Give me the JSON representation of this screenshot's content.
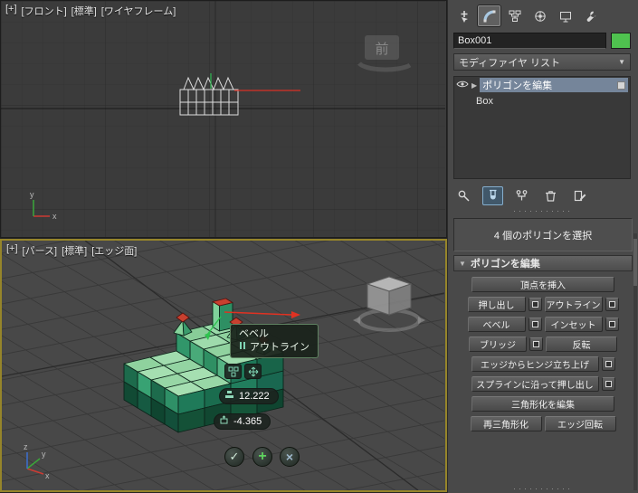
{
  "viewport_front": {
    "menu_plus": "[+]",
    "menu_view": "[フロント]",
    "menu_shading": "[標準]",
    "menu_style": "[ワイヤフレーム]",
    "compass_label": "前"
  },
  "viewport_persp": {
    "menu_plus": "[+]",
    "menu_view": "[パース]",
    "menu_shading": "[標準]",
    "menu_style": "[エッジ面]",
    "caddy": {
      "tooltip_title": "ベベル",
      "tooltip_subtitle": "アウトライン",
      "height_value": "12.222",
      "outline_value": "-4.365",
      "ok_glyph": "✓",
      "apply_glyph": "+",
      "cancel_glyph": "×"
    }
  },
  "command_panel": {
    "object_name": "Box001",
    "object_color": "#4fc24f",
    "modifier_list_label": "モディファイヤ リスト",
    "dropdown_caret": "▼",
    "expand_arrow": "▶",
    "rollout_arrow": "▼",
    "stack_items": [
      {
        "label": "ポリゴンを編集"
      },
      {
        "label": "Box"
      }
    ],
    "selection_status": "4 個のポリゴンを選択",
    "rollout_title": "ポリゴンを編集",
    "buttons": {
      "insert_vertex": "頂点を挿入",
      "extrude": "押し出し",
      "outline": "アウトライン",
      "bevel": "ベベル",
      "inset": "インセット",
      "bridge": "ブリッジ",
      "flip": "反転",
      "hinge_from_edge": "エッジからヒンジ立ち上げ",
      "extrude_along_spline": "スプラインに沿って押し出し",
      "edit_triangulation": "三角形化を編集",
      "retriangulate": "再三角形化",
      "turn": "エッジ回転"
    }
  },
  "icons": {
    "tabs": [
      "create",
      "modify",
      "hierarchy",
      "motion",
      "display",
      "utilities"
    ],
    "stack_tools": [
      "pin-stack",
      "show-end-result",
      "make-unique",
      "remove-modifier",
      "configure-modifier-sets"
    ],
    "model_selected_color": "#c8402f"
  }
}
